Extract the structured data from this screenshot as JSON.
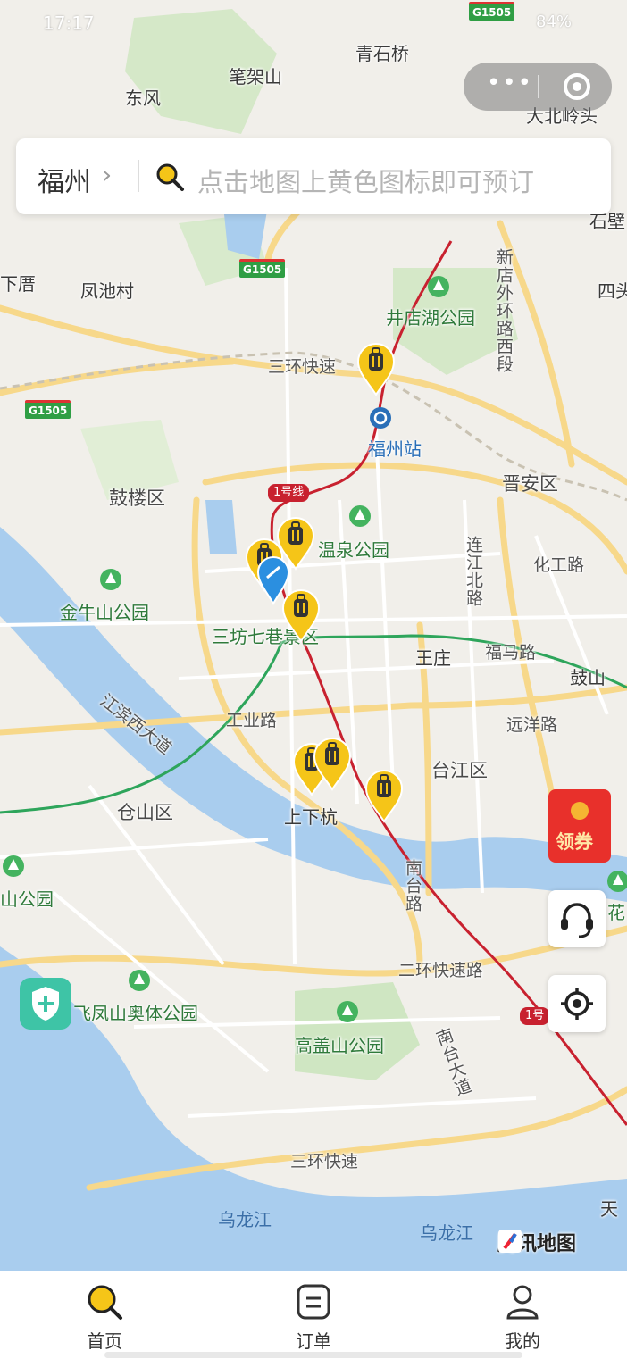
{
  "status_bar": {
    "time": "17:17",
    "battery": "84%"
  },
  "search": {
    "city": "福州",
    "placeholder": "点击地图上黄色图标即可预订"
  },
  "map": {
    "labels": [
      "青石桥",
      "笔架山",
      "东风",
      "大北岭头",
      "石壁",
      "下厝",
      "凤池村",
      "四头",
      "井店湖公园",
      "三环快速",
      "福州站",
      "新店外环路西段",
      "晋安区",
      "鼓楼区",
      "温泉公园",
      "连江北路",
      "化工路",
      "金牛山公园",
      "三坊七巷景区",
      "王庄",
      "福马路",
      "鼓山",
      "江滨西大道",
      "工业路",
      "远洋路",
      "台江区",
      "仓山区",
      "上下杭",
      "南台路",
      "山公园",
      "花",
      "二环快速路",
      "飞凤山奥体公园",
      "高盖山公园",
      "南台大道",
      "三环快速",
      "乌龙江",
      "乌龙江",
      "天"
    ],
    "shields": [
      "G1505",
      "G1505",
      "G1505"
    ],
    "metro_tags": [
      "1号线",
      "1号"
    ],
    "attribution": "腾讯地图"
  },
  "coupon": {
    "label": "领券"
  },
  "tabbar": {
    "items": [
      {
        "label": "首页"
      },
      {
        "label": "订单"
      },
      {
        "label": "我的"
      }
    ]
  },
  "colors": {
    "accent": "#f5c518",
    "metro": "#c8212f",
    "water": "#a9cdee",
    "park": "#cfe6c2"
  }
}
